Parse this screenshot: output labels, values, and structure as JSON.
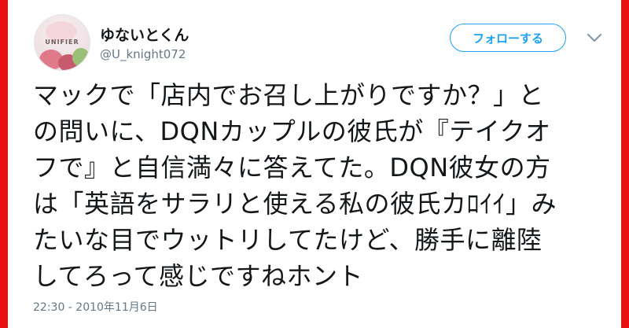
{
  "user": {
    "display_name": "ゆないとくん",
    "handle": "@U_knight072",
    "avatar_text": "UNIFIER"
  },
  "follow_button": {
    "label": "フォローする"
  },
  "tweet": {
    "text": "マックで「店内でお召し上がりですか？」と\nの問いに、DQNカップルの彼氏が『テイクオ\nフで』と自信満々に答えてた。DQN彼女の方\nは「英語をサラリと使える私の彼氏カﾛｲｲ」み\nたいな目でウットリしてたけど、勝手に離陸\nしてろって感じですねホント",
    "timestamp": "22:30 - 2010年11月6日"
  },
  "colors": {
    "frame": "#e8110f",
    "accent": "#1da1f2",
    "text": "#14171a",
    "muted": "#657786"
  },
  "icons": {
    "menu_caret": "chevron-down-icon"
  }
}
